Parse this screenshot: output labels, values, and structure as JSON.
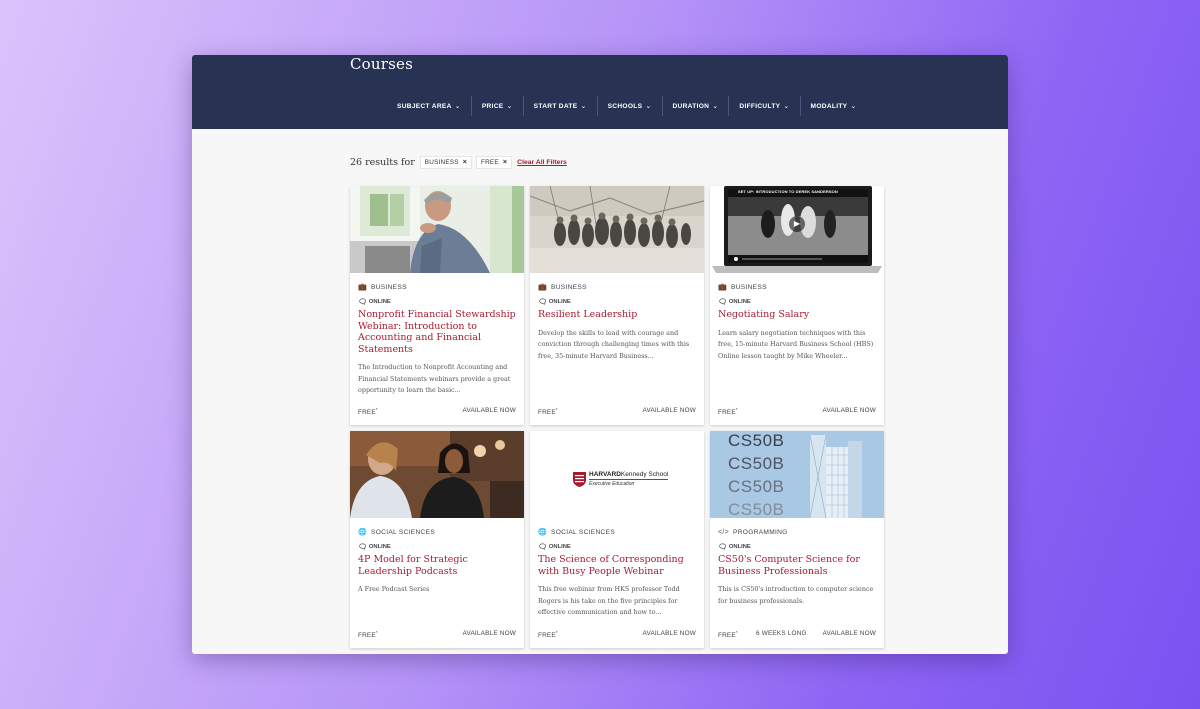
{
  "header": {
    "title": "Courses",
    "filters": [
      {
        "label": "SUBJECT AREA"
      },
      {
        "label": "PRICE"
      },
      {
        "label": "START DATE"
      },
      {
        "label": "SCHOOLS"
      },
      {
        "label": "DURATION"
      },
      {
        "label": "DIFFICULTY"
      },
      {
        "label": "MODALITY"
      }
    ]
  },
  "results": {
    "count_text": "26 results for",
    "chips": [
      {
        "label": "BUSINESS"
      },
      {
        "label": "FREE"
      }
    ],
    "clear_label": "Clear All Filters"
  },
  "courses": [
    {
      "subject": "BUSINESS",
      "subject_icon": "briefcase-icon",
      "modality": "ONLINE",
      "title": "Nonprofit Financial Stewardship Webinar: Introduction to Accounting and Financial Statements",
      "desc": "The Introduction to Nonprofit Accounting and Financial Statements webinars provide a great opportunity to learn the basic...",
      "price": "FREE",
      "price_mark": "*",
      "duration": "",
      "availability": "AVAILABLE NOW"
    },
    {
      "subject": "BUSINESS",
      "subject_icon": "briefcase-icon",
      "modality": "ONLINE",
      "title": "Resilient Leadership",
      "desc": "Develop the skills to lead with courage and conviction through challenging times with this free, 35-minute Harvard Business...",
      "price": "FREE",
      "price_mark": "*",
      "duration": "",
      "availability": "AVAILABLE NOW"
    },
    {
      "subject": "BUSINESS",
      "subject_icon": "briefcase-icon",
      "modality": "ONLINE",
      "title": "Negotiating Salary",
      "desc": "Learn salary negotiation techniques with this free, 15-minute Harvard Business School (HBS) Online lesson taught by Mike Wheeler...",
      "price": "FREE",
      "price_mark": "*",
      "duration": "",
      "availability": "AVAILABLE NOW",
      "video_caption": "SET UP: INTRODUCTION TO DEREK SANDERSON"
    },
    {
      "subject": "SOCIAL SCIENCES",
      "subject_icon": "globe-icon",
      "modality": "ONLINE",
      "title": "4P Model for Strategic Leadership Podcasts",
      "desc": "A Free Podcast Series",
      "price": "FREE",
      "price_mark": "*",
      "duration": "",
      "availability": "AVAILABLE NOW"
    },
    {
      "subject": "SOCIAL SCIENCES",
      "subject_icon": "globe-icon",
      "modality": "ONLINE",
      "title": "The Science of Corresponding with Busy People Webinar",
      "desc": "This free webinar from HKS professor Todd Rogers is his take on the five principles for effective communication and how to...",
      "price": "FREE",
      "price_mark": "*",
      "duration": "",
      "availability": "AVAILABLE NOW",
      "logo_line1_bold": "HARVARD",
      "logo_line1_rest": "Kennedy School",
      "logo_line2": "Executive Education"
    },
    {
      "subject": "PROGRAMMING",
      "subject_icon": "code-icon",
      "modality": "ONLINE",
      "title": "CS50's Computer Science for Business Professionals",
      "desc": "This is CS50's introduction to computer science for business professionals.",
      "price": "FREE",
      "price_mark": "*",
      "duration": "6 WEEKS LONG",
      "availability": "AVAILABLE NOW",
      "banner_text": [
        "CS50B",
        "CS50B",
        "CS50B",
        "CS50B"
      ]
    }
  ],
  "colors": {
    "header_bg": "#283354",
    "title_red": "#a51c30",
    "page_bg": "#f7f7f7"
  }
}
